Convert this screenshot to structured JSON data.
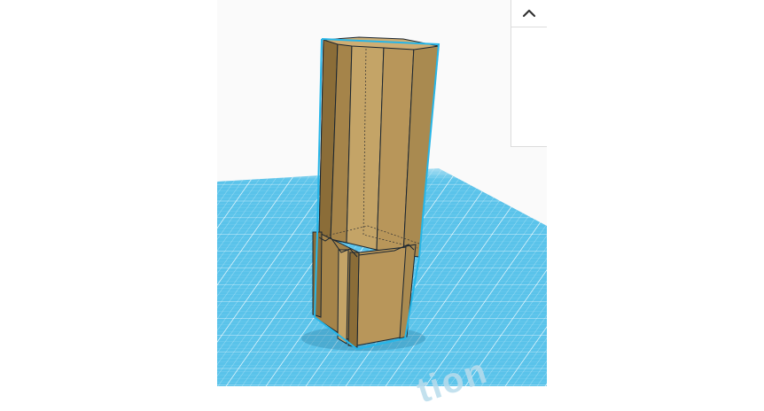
{
  "colors": {
    "plane": "#5ac3ea",
    "plane_grid": "#ffffff",
    "body_fill": "#b8965a",
    "body_dark": "#8b6d38",
    "body_light": "#cfae73",
    "outline": "#1a2530",
    "selection": "#27b6e8",
    "panel_border": "#dcdcdc"
  },
  "panel": {
    "toggle_icon": "chevron-up-icon"
  },
  "workplane": {
    "watermark_text": "tion"
  }
}
